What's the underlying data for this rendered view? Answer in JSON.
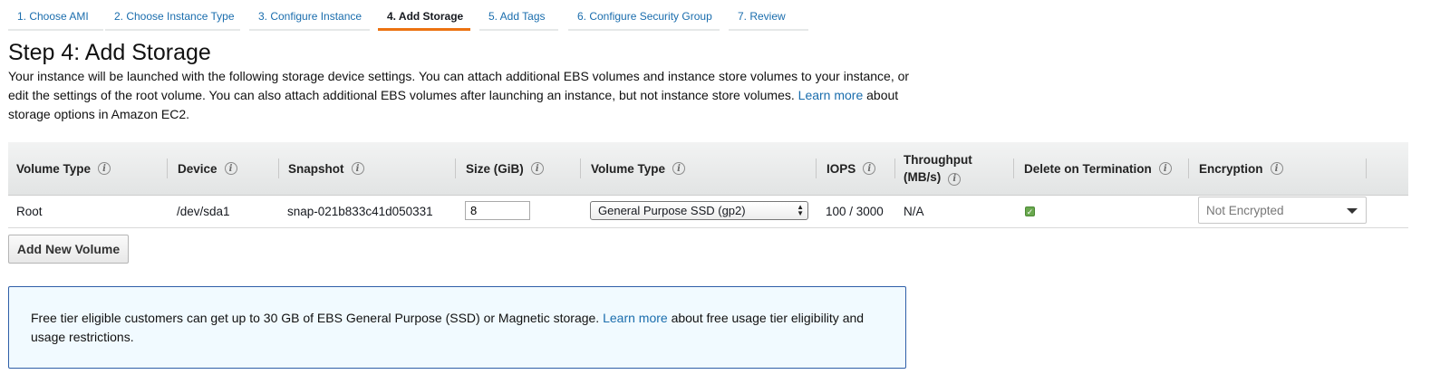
{
  "wizard": {
    "tabs": [
      {
        "label": "1. Choose AMI"
      },
      {
        "label": "2. Choose Instance Type"
      },
      {
        "label": "3. Configure Instance"
      },
      {
        "label": "4. Add Storage"
      },
      {
        "label": "5. Add Tags"
      },
      {
        "label": "6. Configure Security Group"
      },
      {
        "label": "7. Review"
      }
    ],
    "active_tab": "4. Add Storage"
  },
  "page": {
    "title": "Step 4: Add Storage",
    "description_1": "Your instance will be launched with the following storage device settings. You can attach additional EBS volumes and instance store volumes to your instance, or edit the settings of the root volume. You can also attach additional EBS volumes after launching an instance, but not instance store volumes.",
    "learn_more": "Learn more",
    "description_2": "about storage options in Amazon EC2."
  },
  "table": {
    "headers": {
      "volume_type": "Volume Type",
      "device": "Device",
      "snapshot": "Snapshot",
      "size": "Size (GiB)",
      "volume_type_2": "Volume Type",
      "iops": "IOPS",
      "throughput_1": "Throughput",
      "throughput_2": "(MB/s)",
      "delete_on_termination": "Delete on Termination",
      "encryption": "Encryption"
    },
    "rows": [
      {
        "volume_type": "Root",
        "device": "/dev/sda1",
        "snapshot": "snap-021b833c41d050331",
        "size": "8",
        "ebs_volume_type": "General Purpose SSD (gp2)",
        "iops": "100 / 3000",
        "throughput": "N/A",
        "delete_on_termination": true,
        "encryption": "Not Encrypted"
      }
    ]
  },
  "actions": {
    "add_volume_label": "Add New Volume"
  },
  "info": {
    "text_1": "Free tier eligible customers can get up to 30 GB of EBS General Purpose (SSD) or Magnetic storage.",
    "learn_more": "Learn more",
    "text_2": "about free usage tier eligibility and usage restrictions."
  },
  "colors": {
    "link": "#1a6dad",
    "active_tab_underline": "#ec7211",
    "info_border": "#2f5fa8",
    "info_background": "#f1faff",
    "checkbox": "#6aa84f"
  }
}
